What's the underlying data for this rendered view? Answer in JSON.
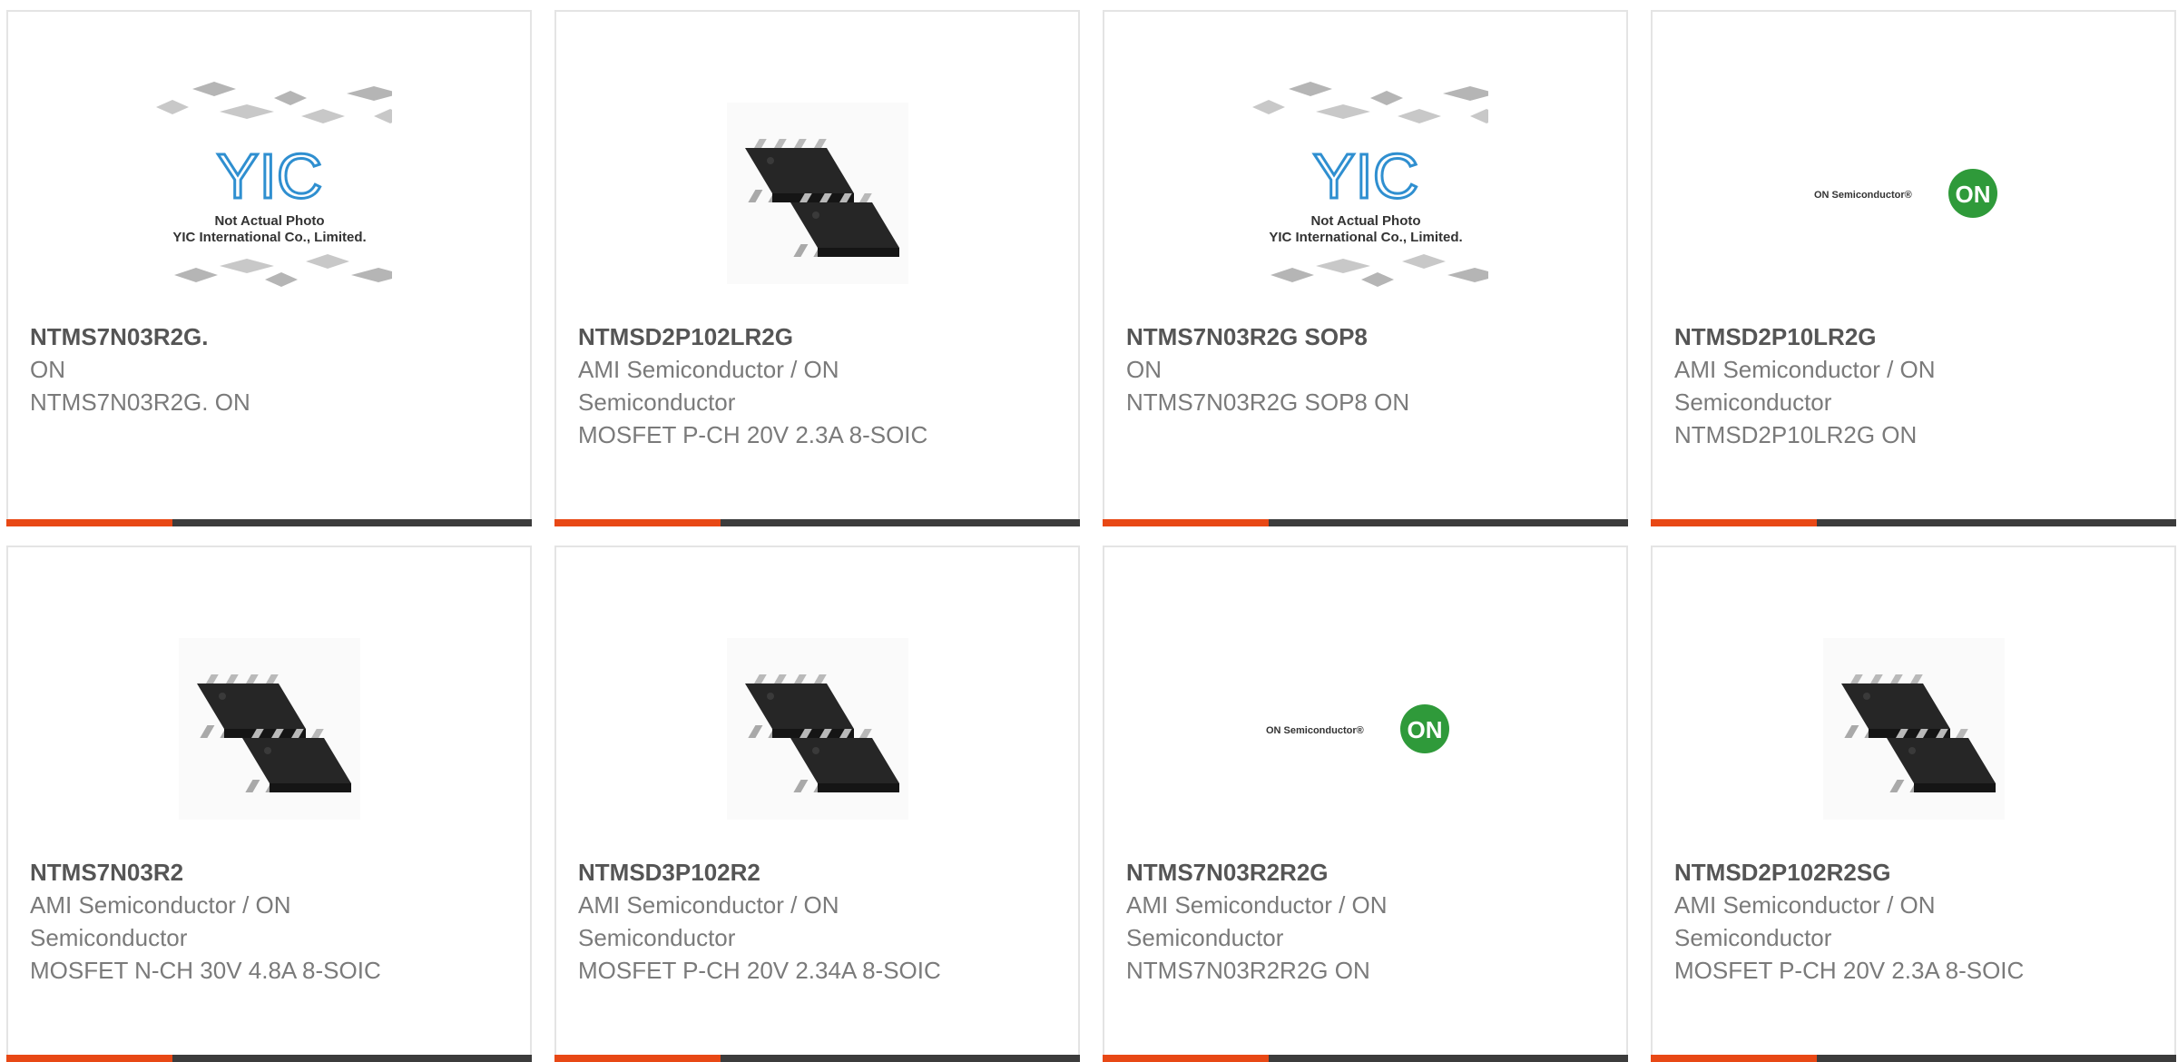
{
  "products": [
    {
      "image": "yic-not-actual-photo",
      "image_caption_lines": [
        "Not Actual Photo",
        "YIC International Co., Limited."
      ],
      "image_logo_text": "YIC",
      "part": "NTMS7N03R2G.",
      "manufacturer": "ON",
      "description": "NTMS7N03R2G. ON"
    },
    {
      "image": "soic8-chip-photo",
      "part": "NTMSD2P102LR2G",
      "manufacturer": "AMI Semiconductor / ON Semiconductor",
      "description": "MOSFET P-CH 20V 2.3A 8-SOIC"
    },
    {
      "image": "yic-not-actual-photo",
      "image_caption_lines": [
        "Not Actual Photo",
        "YIC International Co., Limited."
      ],
      "image_logo_text": "YIC",
      "part": "NTMS7N03R2G SOP8",
      "manufacturer": "ON",
      "description": "NTMS7N03R2G SOP8 ON"
    },
    {
      "image": "on-semiconductor-logo",
      "image_logo_text": "ON Semiconductor®",
      "image_badge_text": "ON",
      "part": "NTMSD2P10LR2G",
      "manufacturer": "AMI Semiconductor / ON Semiconductor",
      "description": "NTMSD2P10LR2G ON"
    },
    {
      "image": "soic8-chip-photo",
      "part": "NTMS7N03R2",
      "manufacturer": "AMI Semiconductor / ON Semiconductor",
      "description": "MOSFET N-CH 30V 4.8A 8-SOIC"
    },
    {
      "image": "soic8-chip-photo",
      "part": "NTMSD3P102R2",
      "manufacturer": "AMI Semiconductor / ON Semiconductor",
      "description": "MOSFET P-CH 20V 2.34A 8-SOIC"
    },
    {
      "image": "on-semiconductor-logo",
      "image_logo_text": "ON Semiconductor®",
      "image_badge_text": "ON",
      "part": "NTMS7N03R2R2G",
      "manufacturer": "AMI Semiconductor / ON Semiconductor",
      "description": "NTMS7N03R2R2G ON"
    },
    {
      "image": "soic8-chip-photo",
      "part": "NTMSD2P102R2SG",
      "manufacturer": "AMI Semiconductor / ON Semiconductor",
      "description": "MOSFET P-CH 20V 2.3A 8-SOIC"
    }
  ],
  "colors": {
    "accent": "#e84815",
    "bar": "#3c3c3c",
    "on_logo_green": "#2f9a3a",
    "yic_blue": "#2f8fd0"
  }
}
